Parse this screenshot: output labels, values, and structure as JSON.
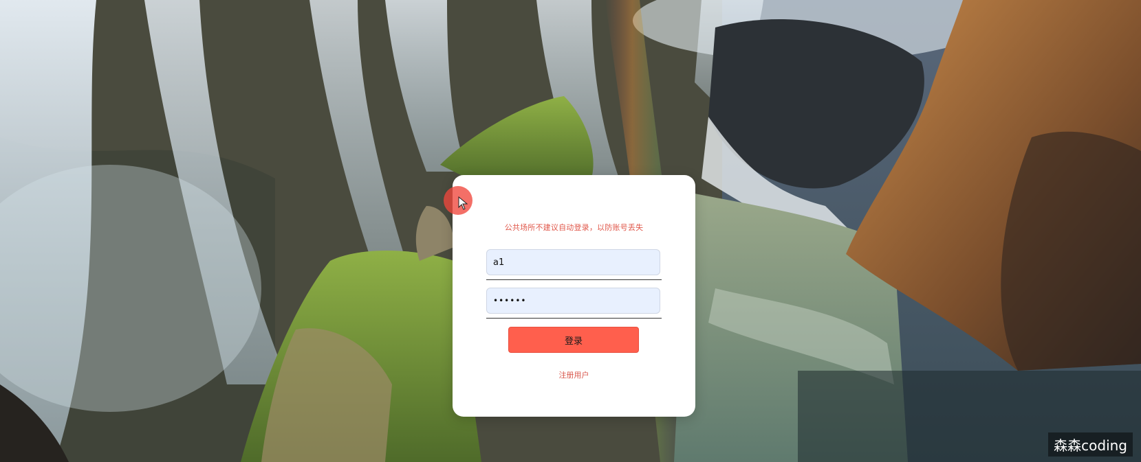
{
  "login": {
    "warning": "公共场所不建议自动登录，以防账号丢失",
    "username_value": "a1",
    "password_value": "••••••",
    "submit_label": "登录",
    "register_label": "注册用户"
  },
  "watermark": "森森coding",
  "colors": {
    "accent": "#ff5f4d",
    "warning_text": "#e0574a",
    "input_fill": "#e8f0fe"
  }
}
